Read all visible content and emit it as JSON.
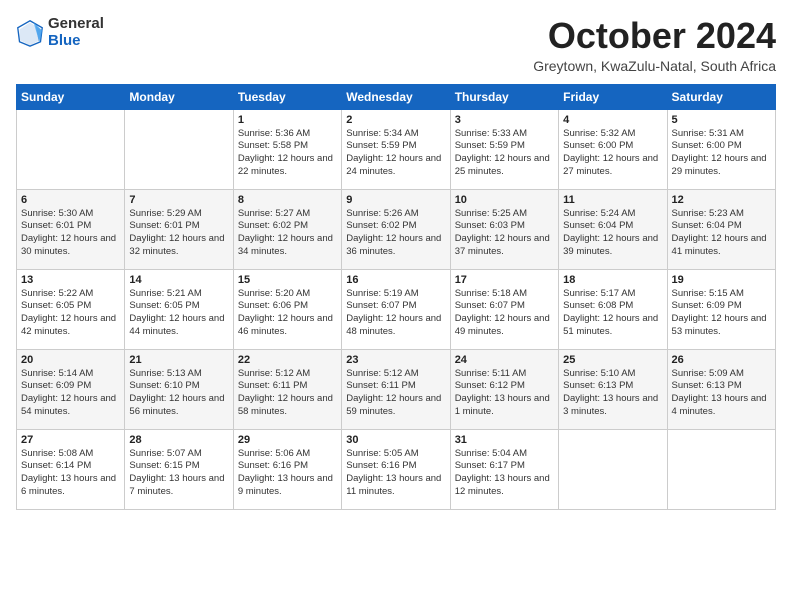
{
  "header": {
    "logo": {
      "general": "General",
      "blue": "Blue"
    },
    "title": "October 2024",
    "location": "Greytown, KwaZulu-Natal, South Africa"
  },
  "days_of_week": [
    "Sunday",
    "Monday",
    "Tuesday",
    "Wednesday",
    "Thursday",
    "Friday",
    "Saturday"
  ],
  "weeks": [
    [
      {
        "day": "",
        "content": ""
      },
      {
        "day": "",
        "content": ""
      },
      {
        "day": "1",
        "content": "Sunrise: 5:36 AM\nSunset: 5:58 PM\nDaylight: 12 hours\nand 22 minutes."
      },
      {
        "day": "2",
        "content": "Sunrise: 5:34 AM\nSunset: 5:59 PM\nDaylight: 12 hours\nand 24 minutes."
      },
      {
        "day": "3",
        "content": "Sunrise: 5:33 AM\nSunset: 5:59 PM\nDaylight: 12 hours\nand 25 minutes."
      },
      {
        "day": "4",
        "content": "Sunrise: 5:32 AM\nSunset: 6:00 PM\nDaylight: 12 hours\nand 27 minutes."
      },
      {
        "day": "5",
        "content": "Sunrise: 5:31 AM\nSunset: 6:00 PM\nDaylight: 12 hours\nand 29 minutes."
      }
    ],
    [
      {
        "day": "6",
        "content": "Sunrise: 5:30 AM\nSunset: 6:01 PM\nDaylight: 12 hours\nand 30 minutes."
      },
      {
        "day": "7",
        "content": "Sunrise: 5:29 AM\nSunset: 6:01 PM\nDaylight: 12 hours\nand 32 minutes."
      },
      {
        "day": "8",
        "content": "Sunrise: 5:27 AM\nSunset: 6:02 PM\nDaylight: 12 hours\nand 34 minutes."
      },
      {
        "day": "9",
        "content": "Sunrise: 5:26 AM\nSunset: 6:02 PM\nDaylight: 12 hours\nand 36 minutes."
      },
      {
        "day": "10",
        "content": "Sunrise: 5:25 AM\nSunset: 6:03 PM\nDaylight: 12 hours\nand 37 minutes."
      },
      {
        "day": "11",
        "content": "Sunrise: 5:24 AM\nSunset: 6:04 PM\nDaylight: 12 hours\nand 39 minutes."
      },
      {
        "day": "12",
        "content": "Sunrise: 5:23 AM\nSunset: 6:04 PM\nDaylight: 12 hours\nand 41 minutes."
      }
    ],
    [
      {
        "day": "13",
        "content": "Sunrise: 5:22 AM\nSunset: 6:05 PM\nDaylight: 12 hours\nand 42 minutes."
      },
      {
        "day": "14",
        "content": "Sunrise: 5:21 AM\nSunset: 6:05 PM\nDaylight: 12 hours\nand 44 minutes."
      },
      {
        "day": "15",
        "content": "Sunrise: 5:20 AM\nSunset: 6:06 PM\nDaylight: 12 hours\nand 46 minutes."
      },
      {
        "day": "16",
        "content": "Sunrise: 5:19 AM\nSunset: 6:07 PM\nDaylight: 12 hours\nand 48 minutes."
      },
      {
        "day": "17",
        "content": "Sunrise: 5:18 AM\nSunset: 6:07 PM\nDaylight: 12 hours\nand 49 minutes."
      },
      {
        "day": "18",
        "content": "Sunrise: 5:17 AM\nSunset: 6:08 PM\nDaylight: 12 hours\nand 51 minutes."
      },
      {
        "day": "19",
        "content": "Sunrise: 5:15 AM\nSunset: 6:09 PM\nDaylight: 12 hours\nand 53 minutes."
      }
    ],
    [
      {
        "day": "20",
        "content": "Sunrise: 5:14 AM\nSunset: 6:09 PM\nDaylight: 12 hours\nand 54 minutes."
      },
      {
        "day": "21",
        "content": "Sunrise: 5:13 AM\nSunset: 6:10 PM\nDaylight: 12 hours\nand 56 minutes."
      },
      {
        "day": "22",
        "content": "Sunrise: 5:12 AM\nSunset: 6:11 PM\nDaylight: 12 hours\nand 58 minutes."
      },
      {
        "day": "23",
        "content": "Sunrise: 5:12 AM\nSunset: 6:11 PM\nDaylight: 12 hours\nand 59 minutes."
      },
      {
        "day": "24",
        "content": "Sunrise: 5:11 AM\nSunset: 6:12 PM\nDaylight: 13 hours\nand 1 minute."
      },
      {
        "day": "25",
        "content": "Sunrise: 5:10 AM\nSunset: 6:13 PM\nDaylight: 13 hours\nand 3 minutes."
      },
      {
        "day": "26",
        "content": "Sunrise: 5:09 AM\nSunset: 6:13 PM\nDaylight: 13 hours\nand 4 minutes."
      }
    ],
    [
      {
        "day": "27",
        "content": "Sunrise: 5:08 AM\nSunset: 6:14 PM\nDaylight: 13 hours\nand 6 minutes."
      },
      {
        "day": "28",
        "content": "Sunrise: 5:07 AM\nSunset: 6:15 PM\nDaylight: 13 hours\nand 7 minutes."
      },
      {
        "day": "29",
        "content": "Sunrise: 5:06 AM\nSunset: 6:16 PM\nDaylight: 13 hours\nand 9 minutes."
      },
      {
        "day": "30",
        "content": "Sunrise: 5:05 AM\nSunset: 6:16 PM\nDaylight: 13 hours\nand 11 minutes."
      },
      {
        "day": "31",
        "content": "Sunrise: 5:04 AM\nSunset: 6:17 PM\nDaylight: 13 hours\nand 12 minutes."
      },
      {
        "day": "",
        "content": ""
      },
      {
        "day": "",
        "content": ""
      }
    ]
  ]
}
